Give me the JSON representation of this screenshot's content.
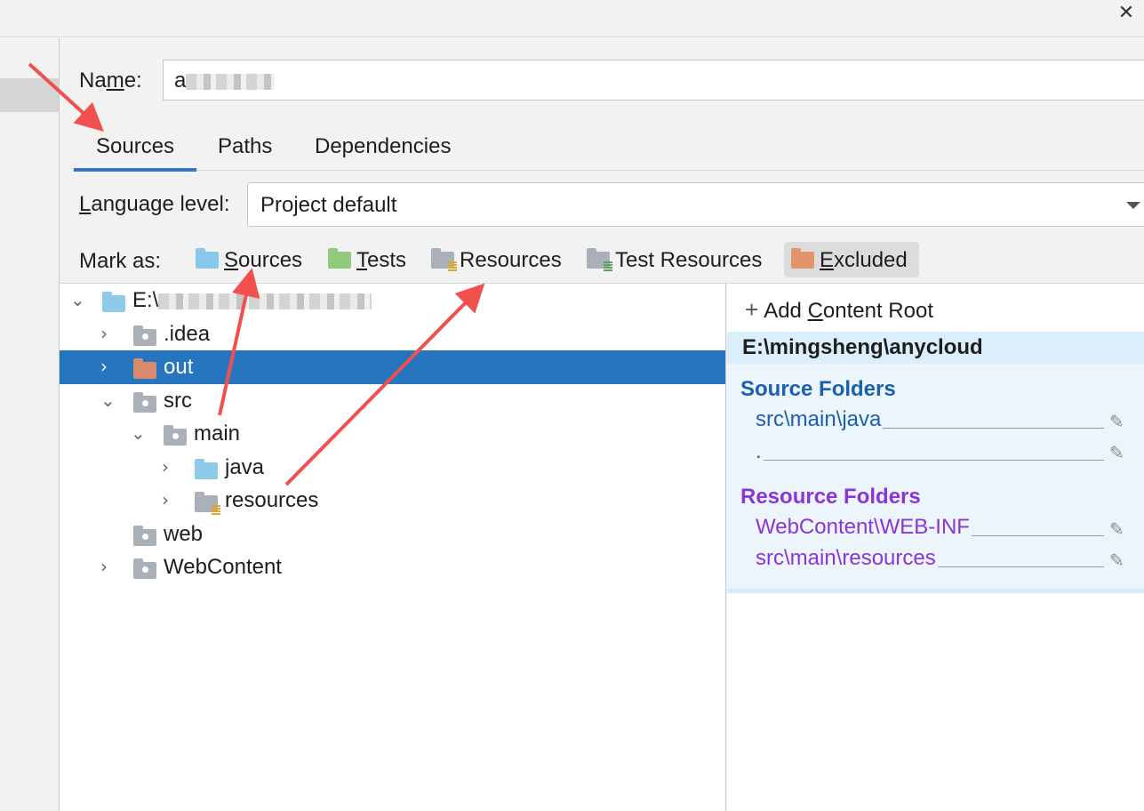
{
  "window": {
    "close_glyph": "✕"
  },
  "name": {
    "label_pre": "Na",
    "label_mnemonic": "m",
    "label_post": "e:",
    "value_visible": "a"
  },
  "tabs": [
    {
      "label": "Sources",
      "active": true
    },
    {
      "label": "Paths",
      "active": false
    },
    {
      "label": "Dependencies",
      "active": false
    }
  ],
  "language": {
    "label_mnemonic": "L",
    "label_rest": "anguage level:",
    "value": "Project default"
  },
  "mark_as": {
    "label": "Mark as:",
    "buttons": [
      {
        "mnemonic": "S",
        "rest": "ources",
        "icon": "sources-folder-icon"
      },
      {
        "mnemonic": "T",
        "rest": "ests",
        "icon": "tests-folder-icon"
      },
      {
        "mnemonic": "",
        "rest": "Resources",
        "icon": "resources-folder-icon"
      },
      {
        "mnemonic": "",
        "rest": "Test Resources",
        "icon": "test-resources-folder-icon"
      },
      {
        "mnemonic": "E",
        "rest": "xcluded",
        "icon": "excluded-folder-icon",
        "pressed": true
      }
    ]
  },
  "tree": {
    "root_prefix": "E:\\",
    "items": [
      {
        "label": ".idea"
      },
      {
        "label": "out"
      },
      {
        "label": "src"
      },
      {
        "label": "main"
      },
      {
        "label": "java"
      },
      {
        "label": "resources"
      },
      {
        "label": "web"
      },
      {
        "label": "WebContent"
      }
    ]
  },
  "content_root": {
    "add_pre": "Add ",
    "add_mnemonic": "C",
    "add_post": "ontent Root",
    "path": "E:\\mingsheng\\anycloud",
    "source_title": "Source Folders",
    "source_folders": [
      "src\\main\\java",
      "."
    ],
    "resource_title": "Resource Folders",
    "resource_folders": [
      "WebContent\\WEB-INF",
      "src\\main\\resources"
    ],
    "edit_glyph": "✎",
    "more_glyph": "⋮"
  },
  "colors": {
    "selection": "#2675bf",
    "tab_underline": "#3574c2",
    "source_text": "#1b5fad",
    "resource_text": "#8a35d8",
    "annotation_arrow": "#f2504f"
  }
}
